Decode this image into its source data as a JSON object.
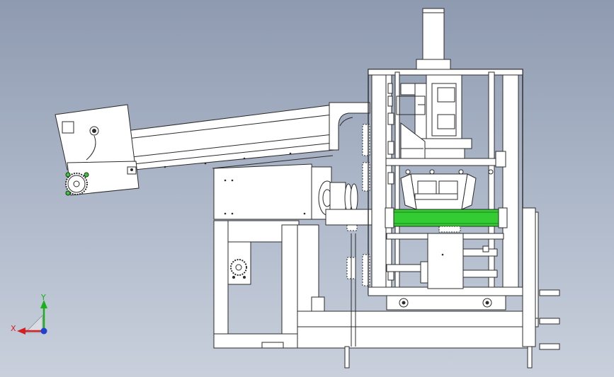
{
  "axes": {
    "x_label": "X",
    "y_label": "Y"
  },
  "colors": {
    "background_top": "#8e9ab0",
    "background_bottom": "#c9d0dc",
    "part_fill": "#ffffff",
    "part_stroke": "#2b2b2b",
    "roller_green": "#33cc33",
    "axis_x": "#d42020",
    "axis_y": "#19b019",
    "axis_z": "#2040d0"
  },
  "icons": {
    "triad": "axis-triad-icon",
    "sprocket": "sprocket-icon",
    "fastener": "bolt-head-icon"
  }
}
